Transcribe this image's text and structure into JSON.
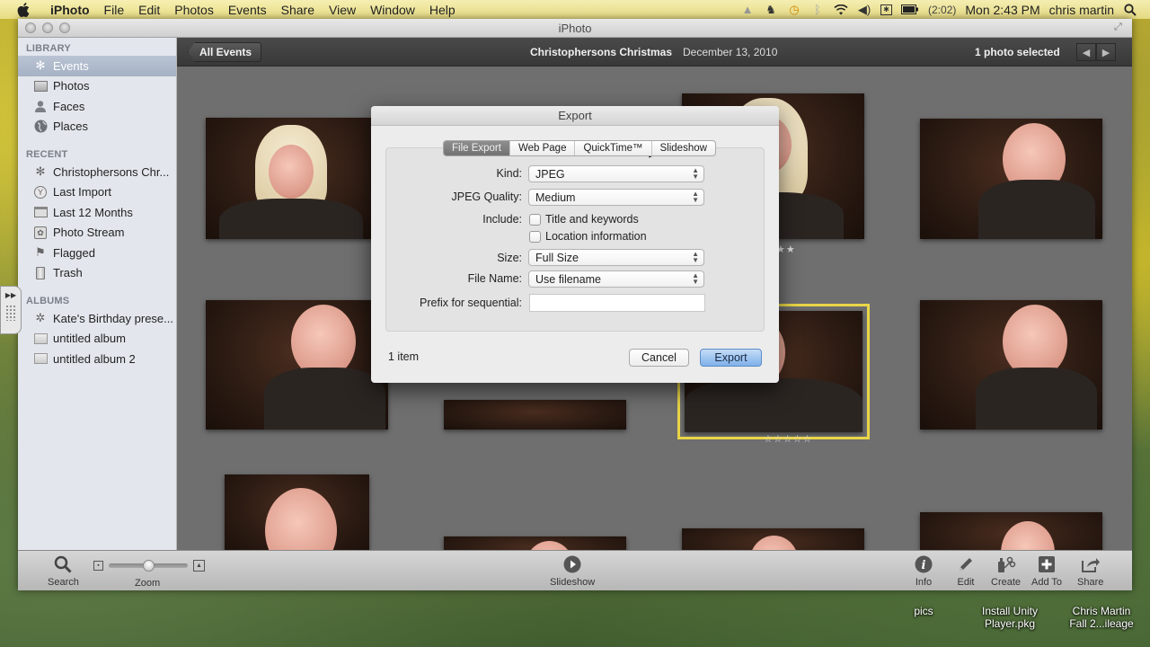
{
  "menubar": {
    "app_name": "iPhoto",
    "menus": [
      "File",
      "Edit",
      "Photos",
      "Events",
      "Share",
      "View",
      "Window",
      "Help"
    ],
    "battery_time": "(2:02)",
    "clock": "Mon 2:43 PM",
    "user": "chris martin",
    "status_icons": [
      "google-drive-icon",
      "evernote-icon",
      "time-machine-icon",
      "bluetooth-icon",
      "wifi-icon",
      "volume-icon",
      "keyboard-icon",
      "battery-icon"
    ]
  },
  "window": {
    "title": "iPhoto"
  },
  "sidebar": {
    "sections": [
      {
        "title": "LIBRARY",
        "items": [
          {
            "label": "Events",
            "icon": "events-palm-icon",
            "selected": true
          },
          {
            "label": "Photos",
            "icon": "photos-icon",
            "selected": false
          },
          {
            "label": "Faces",
            "icon": "faces-icon",
            "selected": false
          },
          {
            "label": "Places",
            "icon": "globe-icon",
            "selected": false
          }
        ]
      },
      {
        "title": "RECENT",
        "items": [
          {
            "label": "Christophersons Chr...",
            "icon": "event-palm-icon"
          },
          {
            "label": "Last Import",
            "icon": "last-import-icon"
          },
          {
            "label": "Last 12 Months",
            "icon": "calendar-icon"
          },
          {
            "label": "Photo Stream",
            "icon": "photo-stream-icon"
          },
          {
            "label": "Flagged",
            "icon": "flag-icon"
          },
          {
            "label": "Trash",
            "icon": "trash-icon"
          }
        ]
      },
      {
        "title": "ALBUMS",
        "items": [
          {
            "label": "Kate's Birthday prese...",
            "icon": "gear-album-icon"
          },
          {
            "label": "untitled album",
            "icon": "album-icon"
          },
          {
            "label": "untitled album 2",
            "icon": "album-icon"
          }
        ]
      }
    ]
  },
  "eventbar": {
    "back_label": "All Events",
    "event_title": "Christophersons Christmas",
    "event_date": "December 13, 2010",
    "selection": "1 photo selected"
  },
  "photos": {
    "ratings": {
      "photo3": "★★",
      "selected": "☆☆☆☆☆"
    }
  },
  "dialog": {
    "title": "Export",
    "tabs": [
      "File Export",
      "Web Page",
      "QuickTime™",
      "Slideshow"
    ],
    "active_tab": "File Export",
    "fields": {
      "kind_label": "Kind:",
      "kind_value": "JPEG",
      "quality_label": "JPEG Quality:",
      "quality_value": "Medium",
      "include_label": "Include:",
      "include_title": "Title and keywords",
      "include_title_checked": false,
      "include_location": "Location information",
      "include_location_checked": false,
      "size_label": "Size:",
      "size_value": "Full Size",
      "filename_label": "File Name:",
      "filename_value": "Use filename",
      "prefix_label": "Prefix for sequential:",
      "prefix_value": ""
    },
    "item_count": "1 item",
    "cancel_label": "Cancel",
    "export_label": "Export"
  },
  "toolbar": {
    "search_label": "Search",
    "zoom_label": "Zoom",
    "zoom_level": 0.5,
    "slideshow_label": "Slideshow",
    "info_label": "Info",
    "edit_label": "Edit",
    "create_label": "Create",
    "add_to_label": "Add To",
    "share_label": "Share"
  },
  "desktop": {
    "icons": [
      {
        "label": "pics"
      },
      {
        "label": "Install Unity\nPlayer.pkg"
      },
      {
        "label": "Chris Martin\nFall 2...ileage"
      }
    ]
  }
}
